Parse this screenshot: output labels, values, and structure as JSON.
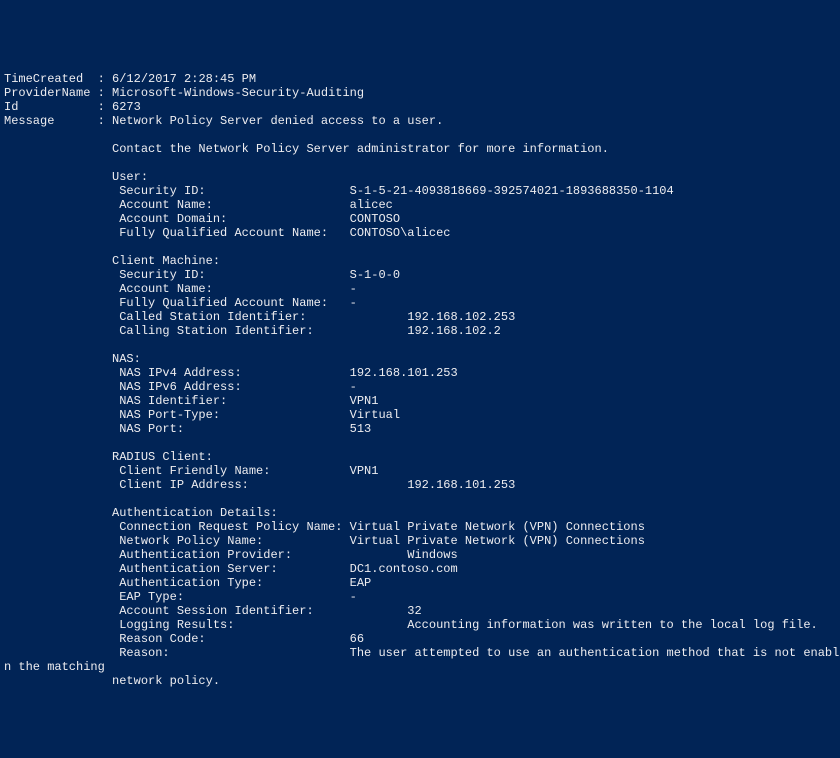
{
  "header": {
    "time_created_label": "TimeCreated  : ",
    "time_created": "6/12/2017 2:28:45 PM",
    "provider_label": "ProviderName : ",
    "provider": "Microsoft-Windows-Security-Auditing",
    "id_label": "Id           : ",
    "id": "6273",
    "message_label": "Message      : ",
    "message": "Network Policy Server denied access to a user."
  },
  "contact_line": "               Contact the Network Policy Server administrator for more information.",
  "user": {
    "header": "               User:",
    "security_id_label": "                Security ID:                    ",
    "security_id": "S-1-5-21-4093818669-392574021-1893688350-1104",
    "account_name_label": "                Account Name:                   ",
    "account_name": "alicec",
    "account_domain_label": "                Account Domain:                 ",
    "account_domain": "CONTOSO",
    "fqan_label": "                Fully Qualified Account Name:   ",
    "fqan": "CONTOSO\\alicec"
  },
  "client": {
    "header": "               Client Machine:",
    "security_id_label": "                Security ID:                    ",
    "security_id": "S-1-0-0",
    "account_name_label": "                Account Name:                   ",
    "account_name": "-",
    "fqan_label": "                Fully Qualified Account Name:   ",
    "fqan": "-",
    "called_label": "                Called Station Identifier:              ",
    "called": "192.168.102.253",
    "calling_label": "                Calling Station Identifier:             ",
    "calling": "192.168.102.2"
  },
  "nas": {
    "header": "               NAS:",
    "ipv4_label": "                NAS IPv4 Address:               ",
    "ipv4": "192.168.101.253",
    "ipv6_label": "                NAS IPv6 Address:               ",
    "ipv6": "-",
    "id_label": "                NAS Identifier:                 ",
    "id": "VPN1",
    "port_type_label": "                NAS Port-Type:                  ",
    "port_type": "Virtual",
    "port_label": "                NAS Port:                       ",
    "port": "513"
  },
  "radius": {
    "header": "               RADIUS Client:",
    "friendly_label": "                Client Friendly Name:           ",
    "friendly": "VPN1",
    "ip_label": "                Client IP Address:                      ",
    "ip": "192.168.101.253"
  },
  "auth": {
    "header": "               Authentication Details:",
    "crp_label": "                Connection Request Policy Name: ",
    "crp": "Virtual Private Network (VPN) Connections",
    "npn_label": "                Network Policy Name:            ",
    "npn": "Virtual Private Network (VPN) Connections",
    "provider_label": "                Authentication Provider:                ",
    "provider": "Windows",
    "server_label": "                Authentication Server:          ",
    "server": "DC1.contoso.com",
    "type_label": "                Authentication Type:            ",
    "type": "EAP",
    "eap_label": "                EAP Type:                       ",
    "eap": "-",
    "session_label": "                Account Session Identifier:             ",
    "session": "32",
    "logging_label": "                Logging Results:                        ",
    "logging": "Accounting information was written to the local log file.",
    "reason_code_label": "                Reason Code:                    ",
    "reason_code": "66",
    "reason_label": "                Reason:                         ",
    "reason": "The user attempted to use an authentication method that is not enabled o",
    "wrap1": "n the matching",
    "wrap2": "               network policy."
  }
}
